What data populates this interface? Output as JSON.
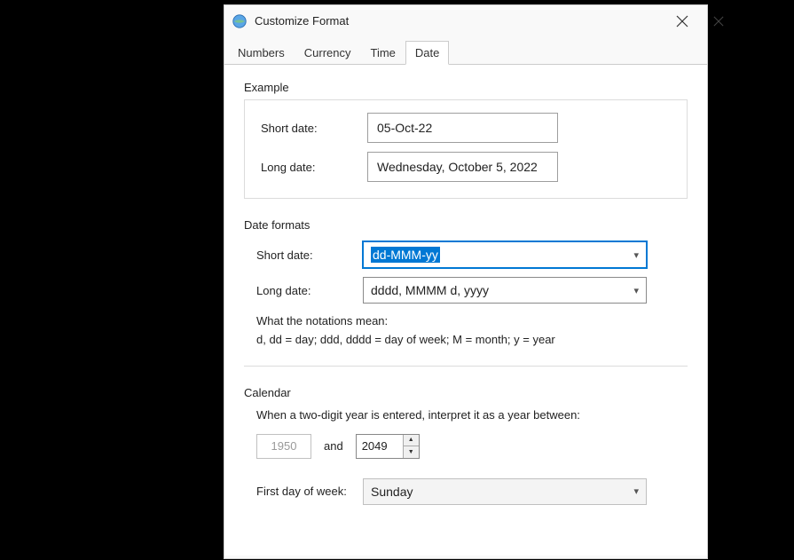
{
  "window": {
    "title": "Customize Format"
  },
  "tabs": {
    "numbers": "Numbers",
    "currency": "Currency",
    "time": "Time",
    "date": "Date"
  },
  "example": {
    "heading": "Example",
    "short_label": "Short date:",
    "long_label": "Long date:",
    "short_value": "05-Oct-22",
    "long_value": "Wednesday, October 5, 2022"
  },
  "formats": {
    "heading": "Date formats",
    "short_label": "Short date:",
    "long_label": "Long date:",
    "short_value": "dd-MMM-yy",
    "long_value": "dddd, MMMM d, yyyy",
    "notation_title": "What the notations mean:",
    "notation_body": "d, dd = day;  ddd, dddd = day of week;  M = month;  y = year"
  },
  "calendar": {
    "heading": "Calendar",
    "two_digit_text": "When a two-digit year is entered, interpret it as a year between:",
    "year_from": "1950",
    "and": "and",
    "year_to": "2049",
    "first_day_label": "First day of week:",
    "first_day_value": "Sunday"
  }
}
